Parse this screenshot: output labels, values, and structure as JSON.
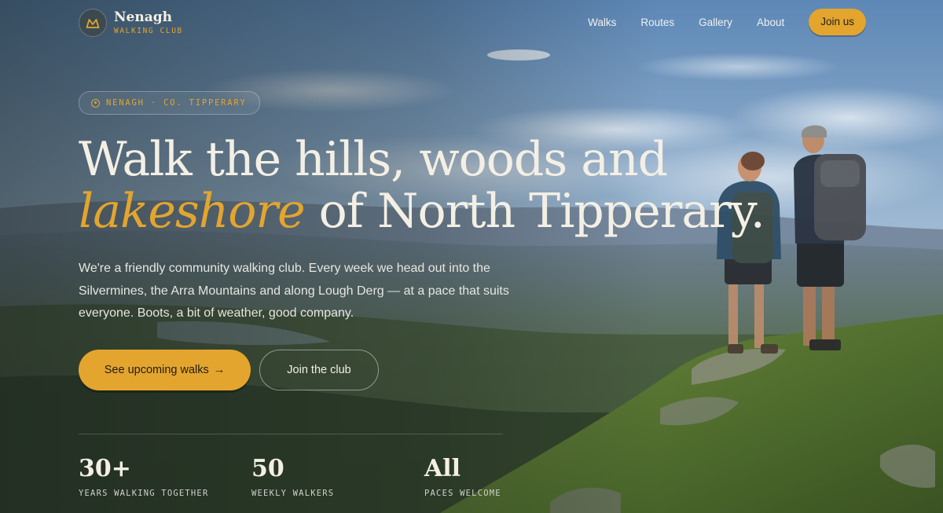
{
  "brand": {
    "name": "Nenagh",
    "subtitle": "WALKING CLUB",
    "logo_icon": "mountain-icon",
    "accent_color": "#e3a52e"
  },
  "nav": {
    "items": [
      "Walks",
      "Routes",
      "Gallery",
      "About"
    ],
    "cta_label": "Join us"
  },
  "hero": {
    "eyebrow_icon": "location-pin-icon",
    "eyebrow": "NENAGH · CO. TIPPERARY",
    "headline_line1": "Walk the hills, woods and",
    "headline_accent": "lakeshore",
    "headline_rest": " of North Tipperary.",
    "lead": "We're a friendly community walking club. Every week we head out into the Silvermines, the Arra Mountains and along Lough Derg — at a pace that suits everyone. Boots, a bit of weather, good company.",
    "primary_button": "See upcoming walks",
    "primary_button_icon": "arrow-right-icon",
    "secondary_button": "Join the club"
  },
  "stats": [
    {
      "value": "30+",
      "label": "YEARS WALKING TOGETHER"
    },
    {
      "value": "50",
      "label": "WEEKLY WALKERS"
    },
    {
      "value": "All",
      "label": "PACES WELCOME"
    }
  ]
}
